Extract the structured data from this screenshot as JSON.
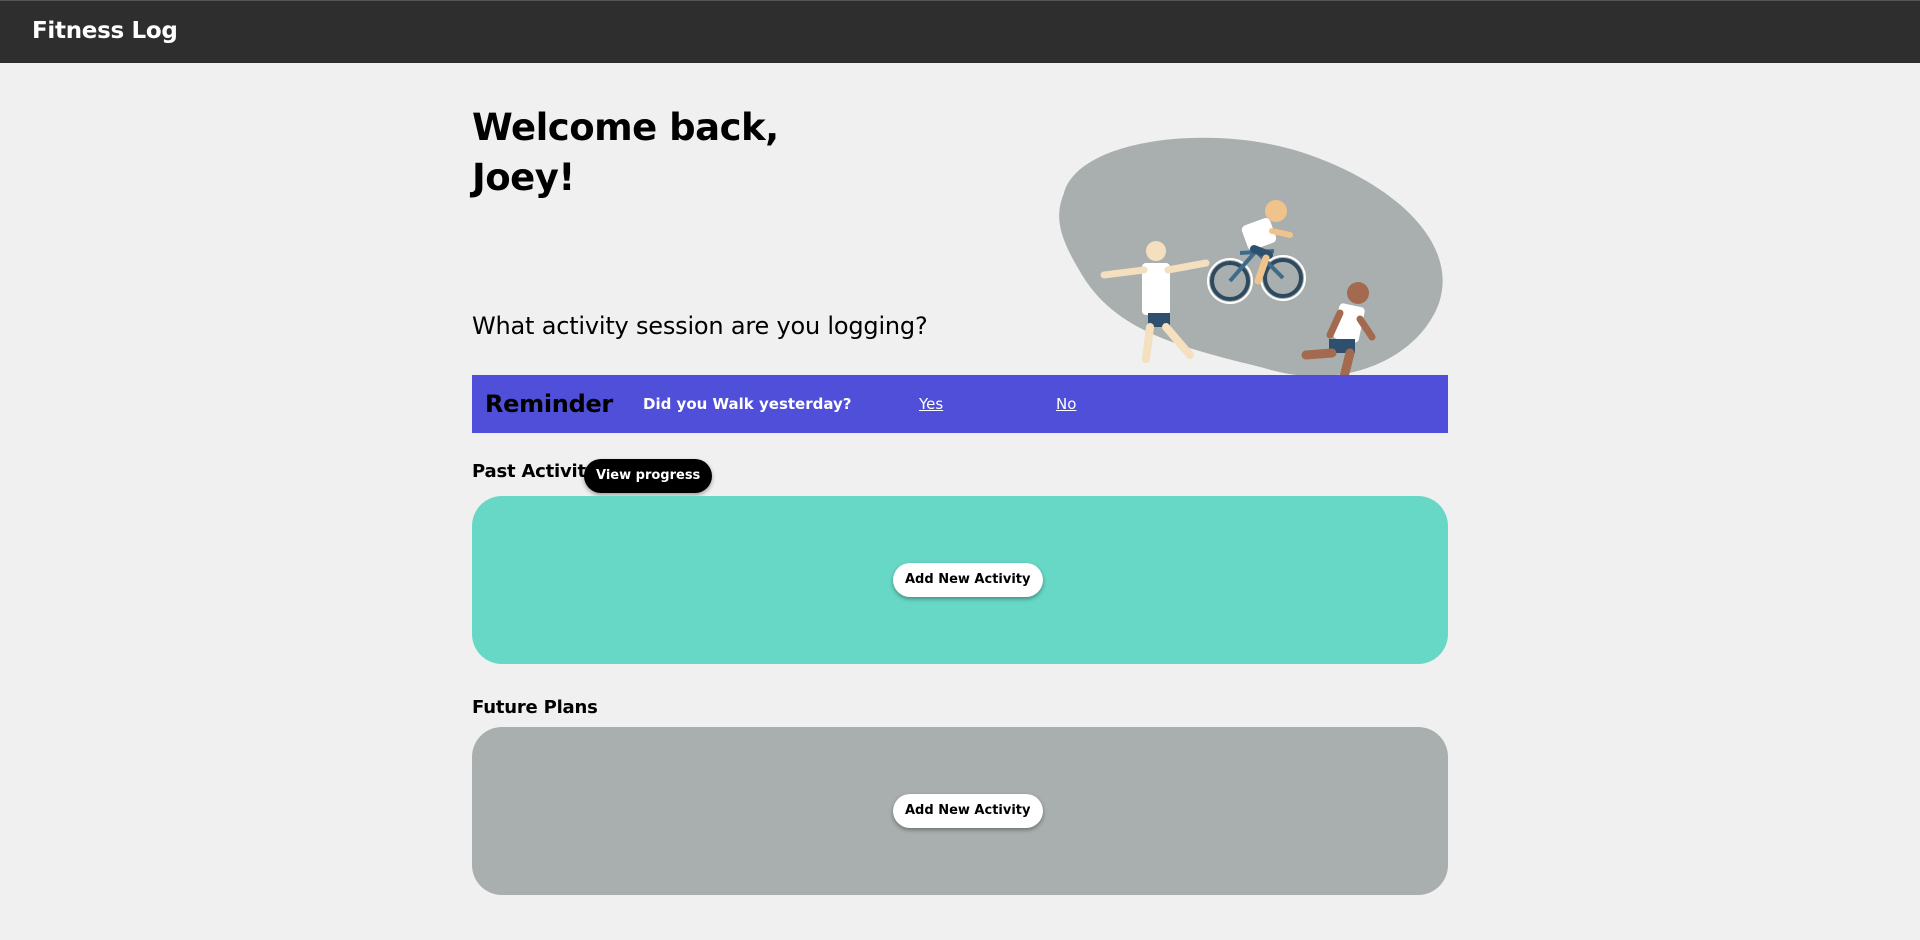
{
  "header": {
    "app_title": "Fitness Log"
  },
  "welcome": {
    "line1": "Welcome back,",
    "line2": "Joey!"
  },
  "prompt": {
    "question": "What activity session are you logging?"
  },
  "illustration": {
    "description_icon": "athletes-illustration-icon"
  },
  "reminder": {
    "title": "Reminder",
    "question": "Did you Walk yesterday?",
    "yes_label": "Yes",
    "no_label": "No",
    "background_color": "#4f4fd9"
  },
  "past_activity": {
    "label": "Past Activity",
    "view_progress_label": "View progress",
    "add_label": "Add New Activity",
    "panel_color": "#68d8c6"
  },
  "future_plans": {
    "label": "Future Plans",
    "add_label": "Add New Activity",
    "panel_color": "#a8afae"
  }
}
